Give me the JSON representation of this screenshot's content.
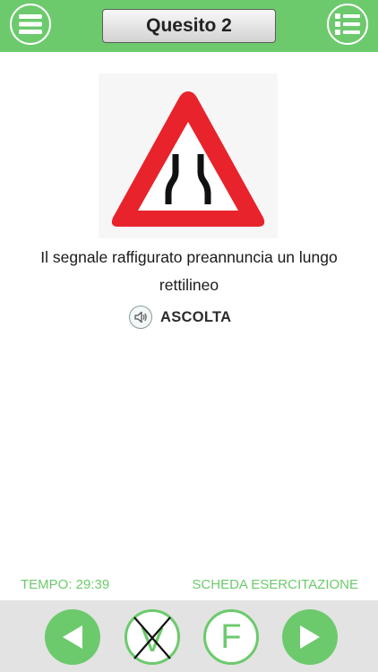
{
  "header": {
    "title": "Quesito 2",
    "menu_icon": "hamburger-menu-icon",
    "list_icon": "question-list-icon"
  },
  "question": {
    "sign": "road-narrows-warning-sign",
    "text": "Il segnale raffigurato preannuncia un lungo rettilineo"
  },
  "listen": {
    "label": "ASCOLTA",
    "icon": "speaker-icon"
  },
  "status": {
    "timer": "TEMPO: 29:39",
    "mode": "SCHEDA ESERCITAZIONE"
  },
  "footer": {
    "true_label": "V",
    "false_label": "F",
    "true_crossed": true
  },
  "colors": {
    "accent": "#6cca6c",
    "sign_red": "#e8232b",
    "footer_bg": "#e3e3e3"
  }
}
